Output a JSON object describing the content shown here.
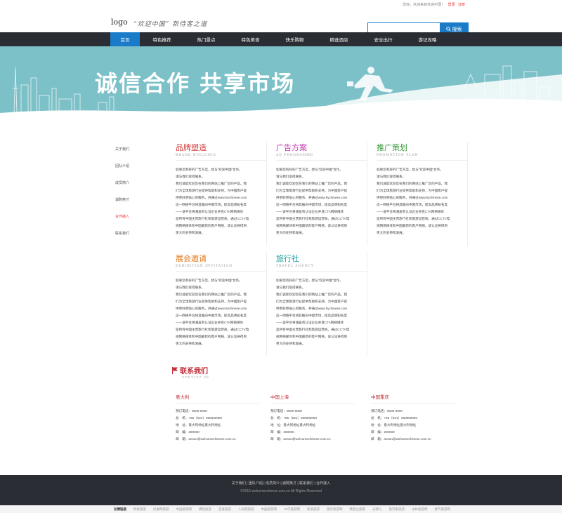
{
  "topbar": {
    "greeting": "您好，欢迎来到欢迎中国！",
    "login": "登录",
    "register": "注册"
  },
  "header": {
    "logo": "logo",
    "slogan": "“欢迎中国” 新侍客之道",
    "search_placeholder": "",
    "search_button": "搜索"
  },
  "nav": [
    "首页",
    "特色推荐",
    "热门景点",
    "特色美食",
    "快乐购物",
    "精选酒店",
    "安全出行",
    "游记攻略"
  ],
  "banner": {
    "title": "诚信合作  共享市场"
  },
  "sidemenu": [
    "关于我们",
    "团队介绍",
    "成员简介",
    "诚聘英才",
    "合作接入",
    "联系我们"
  ],
  "sidemenu_active": 4,
  "cards": [
    {
      "cn": "品牌塑造",
      "en": "BRAND BUILDING",
      "color": "#d23a3a",
      "lines": [
        "如果您有好的广告方案，想与“欢迎中国”合作。",
        "请与我们取得联系。",
        "我们诚挚欢迎您在我们的网站上推广您的产品。我",
        "们为全球旅游行业提供帮助和支持，为中国客户提",
        "供更好更贴心的服务，并通过www.hychinese.com",
        "这一网络平台将其推向中国市场，提高品牌知名度",
        "——该平台将涵盖有认证企业并且CTA网络媒体",
        "是所有中国主营旅行社和旅游运营商。通过CCTV电",
        "视网络媒体和中国最新的客户网络，该认证将得到",
        "更大的支持和发展。"
      ]
    },
    {
      "cn": "广告方案",
      "en": "AD PROGRAMME",
      "color": "#c23ab0",
      "lines": [
        "如果您有好的广告方案，想与“欢迎中国”合作。",
        "请与我们取得联系。",
        "我们诚挚欢迎您在我们的网站上推广您的产品。我",
        "们为全球旅游行业提供帮助和支持，为中国客户提",
        "供更好更贴心的服务，并通过www.hychinese.com",
        "这一网络平台将其推向中国市场，提高品牌知名度",
        "——该平台将涵盖有认证企业并且CTA网络媒体",
        "是所有中国主营旅行社和旅游运营商。通过CCTV电",
        "视网络媒体和中国最新的客户网络，该认证将得到",
        "更大的支持和发展。"
      ]
    },
    {
      "cn": "推广策划",
      "en": "PROMOTION PLAN",
      "color": "#3a9a3a",
      "lines": [
        "如果您有好的广告方案，想与“欢迎中国”合作。",
        "请与我们取得联系。",
        "我们诚挚欢迎您在我们的网站上推广您的产品。我",
        "们为全球旅游行业提供帮助和支持，为中国客户提",
        "供更好更贴心的服务，并通过www.hychinese.com",
        "这一网络平台将其推向中国市场，提高品牌知名度",
        "——该平台将涵盖有认证企业并且CTA网络媒体",
        "是所有中国主营旅行社和旅游运营商。通过CCTV电",
        "视网络媒体和中国最新的客户网络，该认证将得到",
        "更大的支持和发展。"
      ]
    },
    {
      "cn": "展会邀请",
      "en": "EXHIBITION INVITATION",
      "color": "#e07a1e",
      "lines": [
        "如果您有好的广告方案，想与“欢迎中国”合作。",
        "请与我们取得联系。",
        "我们诚挚欢迎您在我们的网站上推广您的产品。我",
        "们为全球旅游行业提供帮助和支持，为中国客户提",
        "供更好更贴心的服务，并通过www.hychinese.com",
        "这一网络平台将其推向中国市场，提高品牌知名度",
        "——该平台将涵盖有认证企业并且CTA网络媒体",
        "是所有中国主营旅行社和旅游运营商。通过CCTV电",
        "视网络媒体和中国最新的客户网络，该认证将得到",
        "更大的支持和发展。"
      ]
    },
    {
      "cn": "旅行社",
      "en": "TRAVEL AGENCY",
      "color": "#1aa0a0",
      "lines": [
        "如果您有好的广告方案，想与“欢迎中国”合作。",
        "请与我们取得联系。",
        "我们诚挚欢迎您在我们的网站上推广您的产品。我",
        "们为全球旅游行业提供帮助和支持，为中国客户提",
        "供更好更贴心的服务，并通过www.hychinese.com",
        "这一网络平台将其推向中国市场，提高品牌知名度",
        "——该平台将涵盖有认证企业并且CTA网络媒体",
        "是所有中国主营旅行社和旅游运营商。通过CCTV电",
        "视网络媒体和中国最新的客户网络，该认证将得到",
        "更大的支持和发展。"
      ]
    }
  ],
  "contact": {
    "title": "联系我们",
    "subtitle": "CONTACT US",
    "offices": [
      {
        "city": "意大利",
        "rows": [
          "预订电话：0000-0000",
          "总　机：+86（021）000000000",
          "地　址：意大利地址意大利地址",
          "邮　编：200000",
          "邮　箱：anson@welcomechinese.com.cn"
        ]
      },
      {
        "city": "中国上海",
        "rows": [
          "预订电话：0000-0000",
          "总　机：+86（021）000000000",
          "地　址：意大利地址意大利地址",
          "邮　编：200000",
          "邮　箱：anson@welcomechinese.com.cn"
        ]
      },
      {
        "city": "中国重庆",
        "rows": [
          "预订电话：0000-0000",
          "总　机：+86（021）000000000",
          "地　址：意大利地址意大利地址",
          "邮　编：200000",
          "邮　箱：anson@welcomechinese.com.cn"
        ]
      }
    ]
  },
  "footer": {
    "links": "关于我们 | 团队介绍 | 成员简介 | 诚聘英才 | 联系我们 | 合作接入",
    "copyright": "©2015 welcomechinese.com.cn All Rights Reserved",
    "friend_label": "友情链接",
    "friend_links": [
      "网易旅游",
      "凤凰网旅游",
      "中国旅游网",
      "携程旅游",
      "百度旅游",
      "人民网旅游",
      "中国旅游网",
      "33学旅游网",
      "新浪旅游",
      "旅行旅游网",
      "携程之旅游",
      "去哪儿",
      "旅行家旅游",
      "米林旅游网",
      "春节旅游网"
    ]
  },
  "colors": {
    "accent": "#1a7bc9",
    "nav_bg": "#2a2d33",
    "banner": "#7cc1c8",
    "contact_red": "#c0303a"
  }
}
